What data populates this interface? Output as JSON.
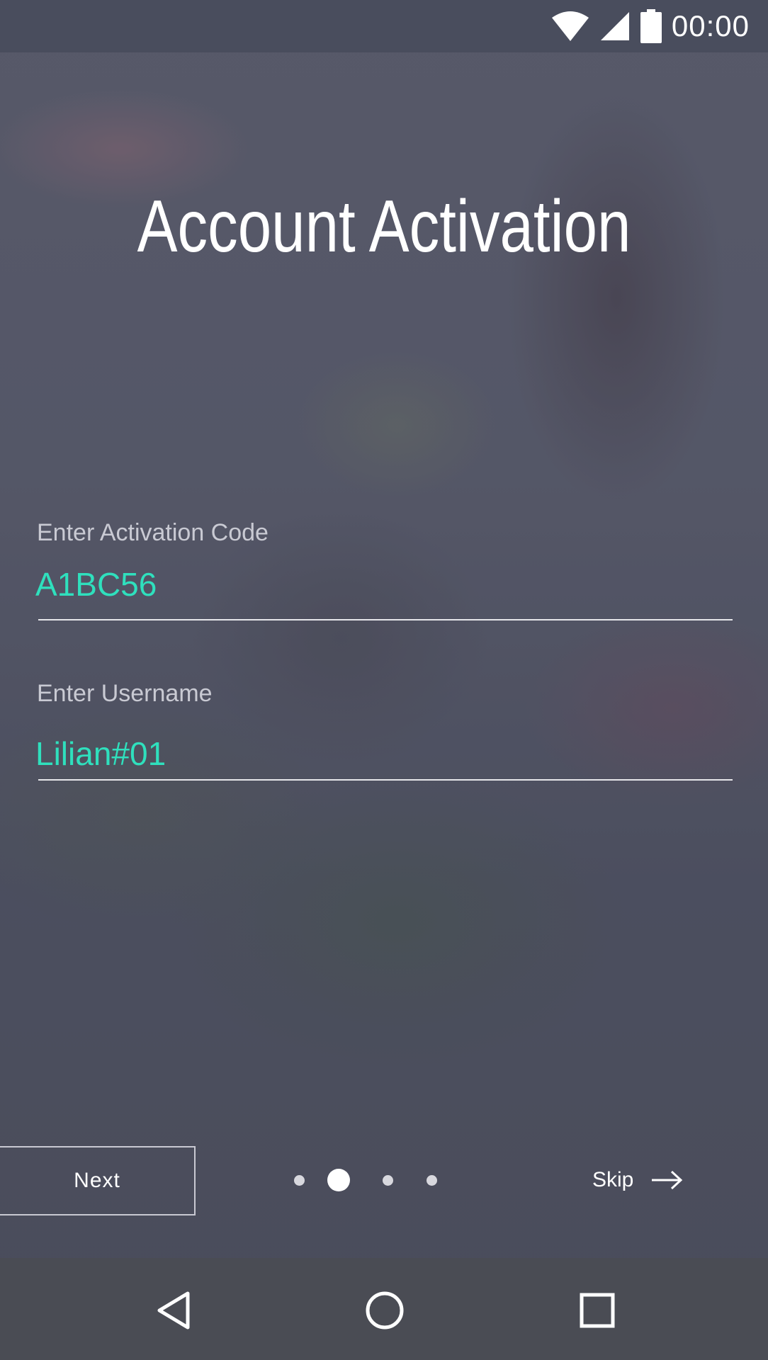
{
  "status_bar": {
    "time": "00:00",
    "icons": [
      "wifi-icon",
      "signal-icon",
      "battery-icon"
    ]
  },
  "page": {
    "title": "Account Activation"
  },
  "form": {
    "activation_code": {
      "label": "Enter Activation Code",
      "value": "A1BC56"
    },
    "username": {
      "label": "Enter Username",
      "value": "Lilian#01"
    }
  },
  "footer": {
    "next_label": "Next",
    "skip_label": "Skip",
    "pager": {
      "total": 4,
      "active_index": 1
    }
  },
  "nav_bar": {
    "icons": [
      "back-icon",
      "home-icon",
      "recents-icon"
    ]
  },
  "colors": {
    "accent": "#2fe0bd",
    "text_primary": "#ffffff",
    "label": "#c9cad3",
    "nav_bar": "#4a4c54",
    "status_bar": "#484c5c"
  }
}
